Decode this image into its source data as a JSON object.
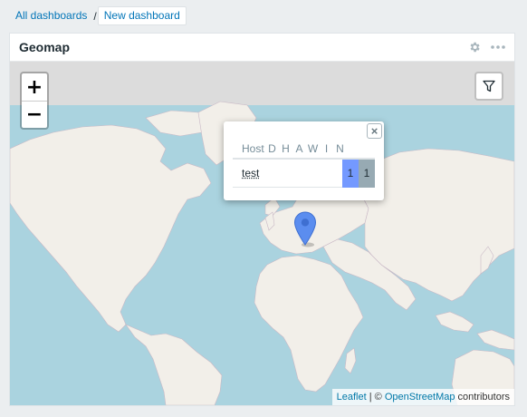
{
  "breadcrumb": {
    "parent": "All dashboards",
    "separator": "/",
    "current": "New dashboard"
  },
  "widget": {
    "title": "Geomap",
    "actions": [
      {
        "name": "settings",
        "icon": "gear-icon"
      },
      {
        "name": "more",
        "icon": "more-dots-icon"
      }
    ]
  },
  "map": {
    "zoom_in": "+",
    "zoom_out": "−",
    "filter_icon": "filter-icon",
    "popup": {
      "close": "×",
      "columns": {
        "host": "Host",
        "severities": [
          "D",
          "H",
          "A",
          "W",
          "I",
          "N"
        ]
      },
      "rows": [
        {
          "host": "test",
          "information": "1",
          "not_classified": "1"
        }
      ]
    },
    "attribution": {
      "leaflet": "Leaflet",
      "separator": " | © ",
      "osm": "OpenStreetMap",
      "suffix": " contributors"
    },
    "colors": {
      "water": "#aad3df",
      "land": "#f2efe9",
      "information": "#7499ff",
      "not_classified": "#97aab3",
      "marker": "#5b8def"
    }
  }
}
